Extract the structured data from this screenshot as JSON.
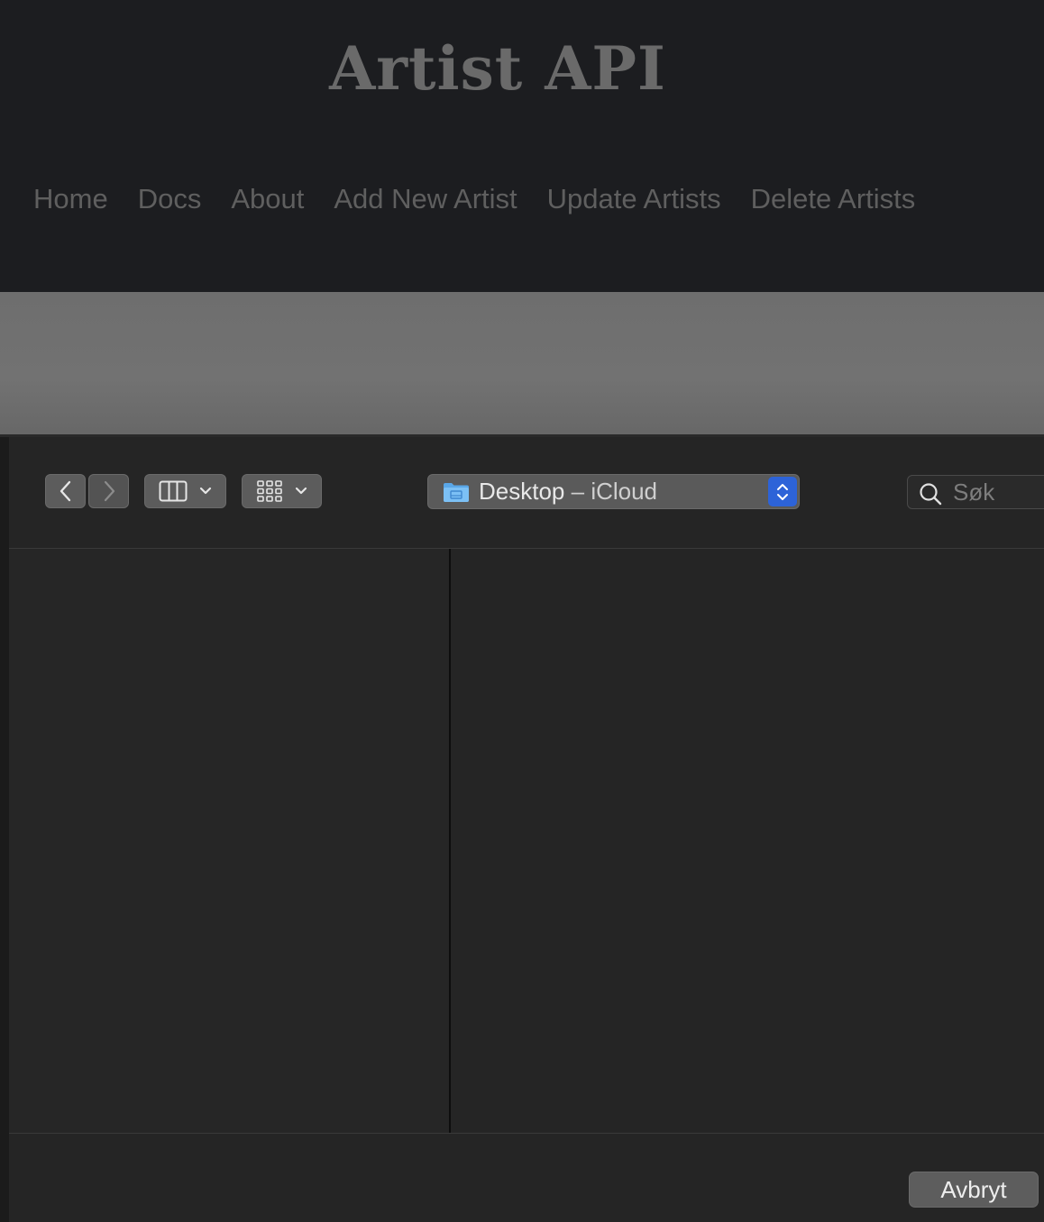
{
  "site": {
    "title": "Artist API",
    "nav": [
      {
        "label": "Home"
      },
      {
        "label": "Docs"
      },
      {
        "label": "About"
      },
      {
        "label": "Add New Artist"
      },
      {
        "label": "Update Artists"
      },
      {
        "label": "Delete Artists"
      }
    ]
  },
  "dialog": {
    "location": {
      "name": "Desktop",
      "separator": " – ",
      "service": "iCloud",
      "icon": "folder-icon"
    },
    "search": {
      "placeholder": "Søk",
      "value": ""
    },
    "toolbar": {
      "back_icon": "chevron-left-icon",
      "forward_icon": "chevron-right-icon",
      "view_icon": "columns-view-icon",
      "group_icon": "grid-group-icon"
    },
    "buttons": {
      "cancel_label": "Avbryt"
    }
  },
  "colors": {
    "accent": "#2d63d8",
    "header_bg": "#1c1d20",
    "dialog_bg": "#252525"
  }
}
